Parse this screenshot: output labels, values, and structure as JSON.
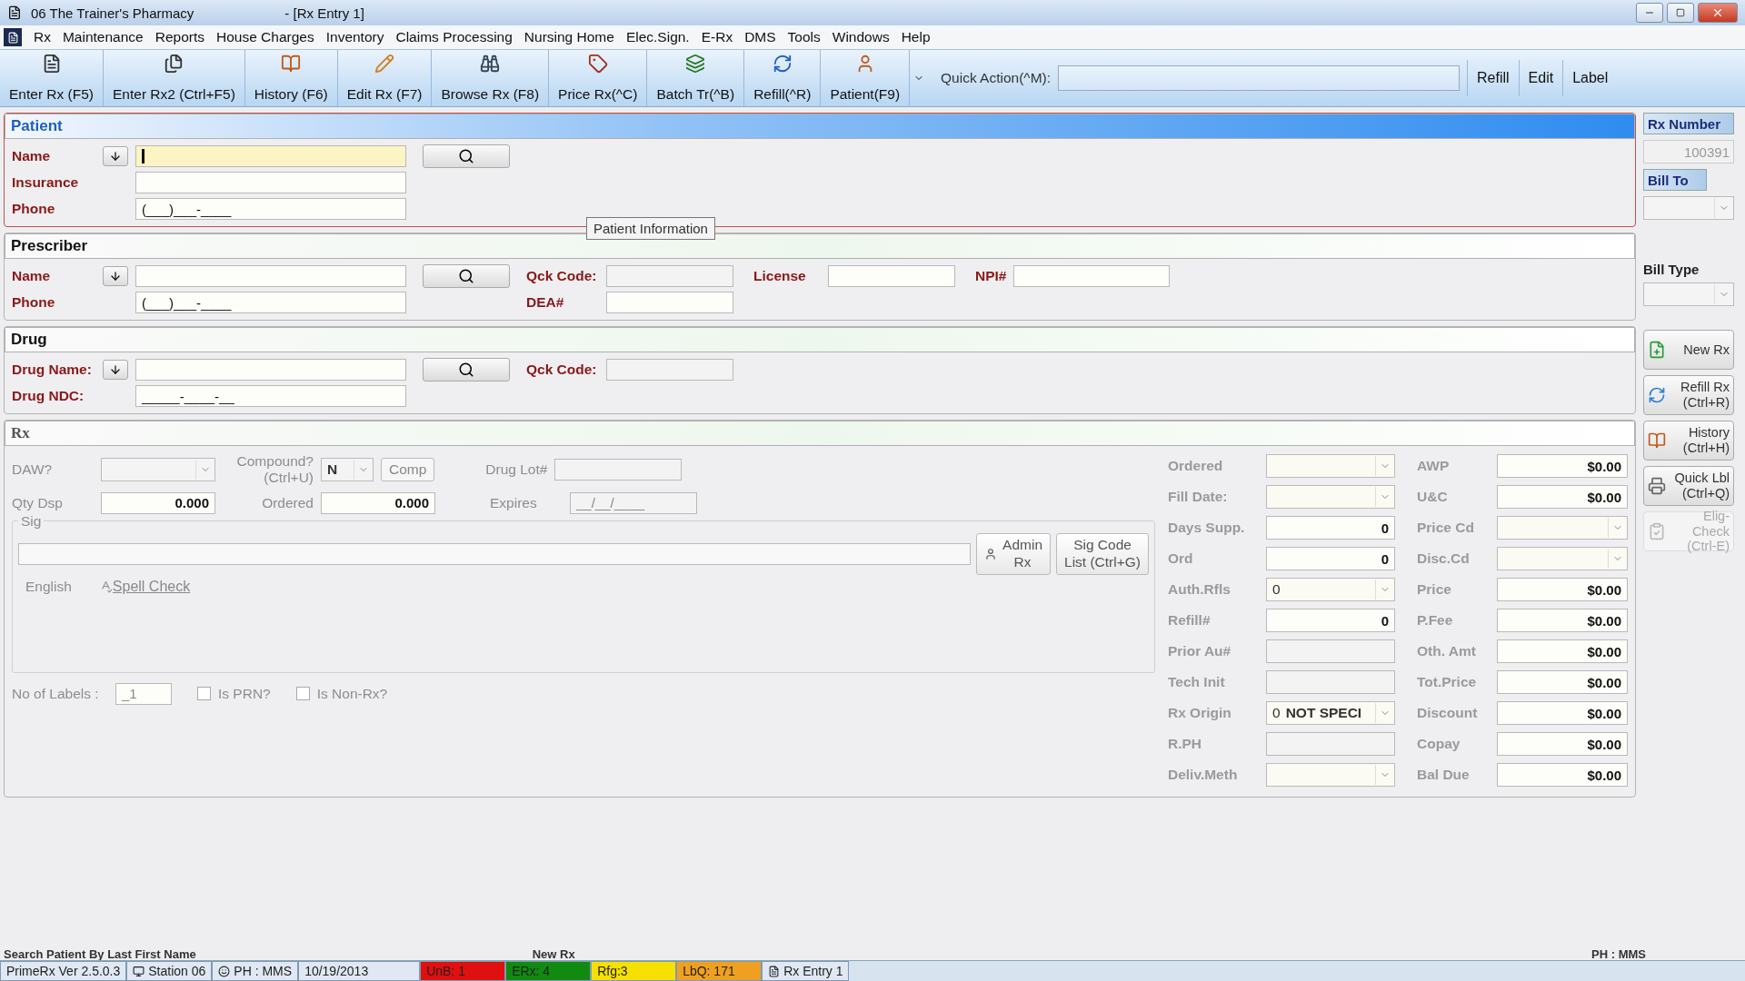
{
  "window": {
    "title": "06 The Trainer's Pharmacy",
    "document": "- [Rx Entry 1]"
  },
  "menu": [
    "Rx",
    "Maintenance",
    "Reports",
    "House Charges",
    "Inventory",
    "Claims Processing",
    "Nursing Home",
    "Elec.Sign.",
    "E-Rx",
    "DMS",
    "Tools",
    "Windows",
    "Help"
  ],
  "toolbar": {
    "buttons": [
      "Enter Rx (F5)",
      "Enter Rx2 (Ctrl+F5)",
      "History (F6)",
      "Edit Rx (F7)",
      "Browse Rx (F8)",
      "Price Rx(^C)",
      "Batch Tr(^B)",
      "Refill(^R)",
      "Patient(F9)"
    ],
    "quick_action": "Quick Action(^M):",
    "links": [
      "Refill",
      "Edit",
      "Label"
    ]
  },
  "patient": {
    "title": "Patient",
    "fields": [
      {
        "label": "Name",
        "kind": "lookup",
        "focused": true
      },
      {
        "label": "Insurance",
        "kind": "text",
        "focused": false
      },
      {
        "label": "Phone",
        "kind": "text",
        "value": "(___)___-____",
        "focused": false
      }
    ],
    "tooltip": "Patient Information"
  },
  "prescriber": {
    "title": "Prescriber",
    "name_label": "Name",
    "phone_label": "Phone",
    "phone_value": "(___)___-____",
    "qck_code_label": "Qck Code:",
    "license_label": "License",
    "npi_label": "NPI#",
    "dea_label": "DEA#"
  },
  "drug": {
    "title": "Drug",
    "name_label": "Drug Name:",
    "ndc_label": "Drug NDC:",
    "ndc_value": "_____-____-__",
    "qck_code_label": "Qck Code:"
  },
  "rx": {
    "title": "Rx",
    "daw_label": "DAW?",
    "compound_label": [
      "Compound?",
      "(Ctrl+U)"
    ],
    "compound_value": "N",
    "comp_button": "Comp",
    "drug_lot_label": "Drug Lot#",
    "qty_label": "Qty Dsp",
    "qty_value": "0.000",
    "ordered_label": "Ordered",
    "ordered_value": "0.000",
    "expires_label": "Expires",
    "expires_value": "__/__/____",
    "sig_label": "Sig",
    "admin_button": [
      "Admin",
      "Rx"
    ],
    "sig_code_button": [
      "Sig Code",
      "List (Ctrl+G)"
    ],
    "language": "English",
    "spell_check": "Spell Check",
    "labels_label": "No of Labels :",
    "labels_value": "_1",
    "checkboxes": [
      {
        "label": "Is PRN?",
        "checked": false
      },
      {
        "label": "Is Non-Rx?",
        "checked": false
      }
    ],
    "details": [
      {
        "label": "Ordered",
        "kind": "select"
      },
      {
        "label": "Fill Date:",
        "kind": "select"
      },
      {
        "label": "Days Supp.",
        "kind": "number",
        "value": "0"
      },
      {
        "label": "Ord",
        "kind": "number",
        "value": "0"
      },
      {
        "label": "Auth.Rfls",
        "kind": "select",
        "value": "0"
      },
      {
        "label": "Refill#",
        "kind": "number",
        "value": "0"
      },
      {
        "label": "Prior Au#",
        "kind": "text"
      },
      {
        "label": "Tech Init",
        "kind": "text"
      },
      {
        "label": "Rx Origin",
        "kind": "select",
        "code": "0",
        "value": "NOT SPECI"
      },
      {
        "label": "R.PH",
        "kind": "text"
      },
      {
        "label": "Deliv.Meth",
        "kind": "select"
      }
    ],
    "pricing": [
      {
        "label": "AWP",
        "kind": "number",
        "value": "$0.00"
      },
      {
        "label": "U&C",
        "kind": "number",
        "value": "$0.00"
      },
      {
        "label": "Price Cd",
        "kind": "select"
      },
      {
        "label": "Disc.Cd",
        "kind": "select"
      },
      {
        "label": "Price",
        "kind": "number",
        "value": "$0.00"
      },
      {
        "label": "P.Fee",
        "kind": "number",
        "value": "$0.00"
      },
      {
        "label": "Oth. Amt",
        "kind": "number",
        "value": "$0.00"
      },
      {
        "label": "Tot.Price",
        "kind": "number",
        "value": "$0.00"
      },
      {
        "label": "Discount",
        "kind": "number",
        "value": "$0.00"
      },
      {
        "label": "Copay",
        "kind": "number",
        "value": "$0.00"
      },
      {
        "label": "Bal Due",
        "kind": "number",
        "value": "$0.00"
      }
    ]
  },
  "sidebar": {
    "rx_number_label": "Rx Number",
    "rx_number": "100391",
    "bill_to_label": "Bill To",
    "bill_type_label": "Bill Type",
    "buttons": [
      {
        "label": [
          "New Rx"
        ],
        "disabled": false
      },
      {
        "label": [
          "Refill Rx",
          "(Ctrl+R)"
        ],
        "disabled": false
      },
      {
        "label": [
          "History",
          "(Ctrl+H)"
        ],
        "disabled": false
      },
      {
        "label": [
          "Quick Lbl",
          "(Ctrl+Q)"
        ],
        "disabled": false
      },
      {
        "label": [
          "Elig-Check",
          "(Ctrl-E)"
        ],
        "disabled": true
      }
    ]
  },
  "hint": {
    "left": "Search Patient By Last First Name",
    "center": "New Rx",
    "right": "PH : MMS"
  },
  "status_bar": [
    {
      "text": "PrimeRx Ver 2.5.0.3"
    },
    {
      "text": "Station 06"
    },
    {
      "text": "PH : MMS"
    },
    {
      "text": "10/19/2013"
    },
    {
      "text": "UnB: 1",
      "color": "#e01010"
    },
    {
      "text": "ERx: 4",
      "color": "#108a10"
    },
    {
      "text": "Rfg:3",
      "color": "#f5e000"
    },
    {
      "text": "LbQ: 171",
      "color": "#f0a020"
    },
    {
      "text": "Rx Entry 1"
    }
  ]
}
